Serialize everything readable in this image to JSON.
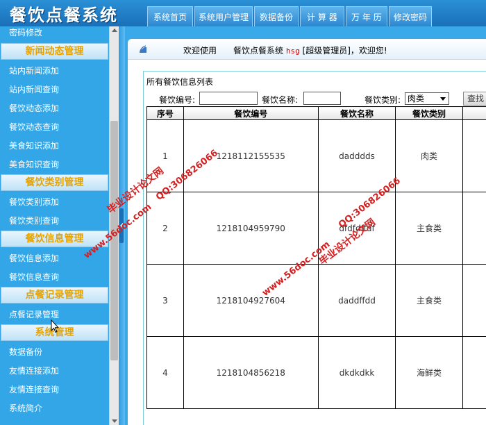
{
  "app": {
    "title": "餐饮点餐系统"
  },
  "nav": {
    "tabs": [
      {
        "label": "系统首页"
      },
      {
        "label": "系统用户管理"
      },
      {
        "label": "数据备份"
      },
      {
        "label": "计 算 器"
      },
      {
        "label": "万 年 历"
      },
      {
        "label": "修改密码"
      }
    ]
  },
  "sidebar": {
    "top_item": "密码修改",
    "groups": [
      {
        "title": "新闻动态管理",
        "items": [
          "站内新闻添加",
          "站内新闻查询",
          "餐饮动态添加",
          "餐饮动态查询",
          "美食知识添加",
          "美食知识查询"
        ]
      },
      {
        "title": "餐饮类别管理",
        "items": [
          "餐饮类别添加",
          "餐饮类别查询"
        ]
      },
      {
        "title": "餐饮信息管理",
        "items": [
          "餐饮信息添加",
          "餐饮信息查询"
        ]
      },
      {
        "title": "点餐记录管理",
        "items": [
          "点餐记录管理"
        ]
      },
      {
        "title": "系统管理",
        "items": [
          "数据备份",
          "友情连接添加",
          "友情连接查询",
          "系统简介"
        ]
      }
    ]
  },
  "welcome": {
    "label": "欢迎使用",
    "system": "餐饮点餐系统",
    "user": "hsg",
    "role_text": "[超级管理员]，欢迎您!"
  },
  "panel": {
    "title": "所有餐饮信息列表"
  },
  "filters": {
    "code_label": "餐饮编号:",
    "code_value": "",
    "name_label": "餐饮名称:",
    "name_value": "",
    "type_label": "餐饮类别:",
    "type_selected": "肉类",
    "search_button": "查找"
  },
  "table": {
    "headers": [
      "序号",
      "餐饮编号",
      "餐饮名称",
      "餐饮类别"
    ],
    "rows": [
      {
        "no": "1",
        "code": "1218112155535",
        "name": "dadddds",
        "type": "肉类"
      },
      {
        "no": "2",
        "code": "1218104959790",
        "name": "dfdfdffdf",
        "type": "主食类"
      },
      {
        "no": "3",
        "code": "1218104927604",
        "name": "daddffdd",
        "type": "主食类"
      },
      {
        "no": "4",
        "code": "1218104856218",
        "name": "dkdkdkk",
        "type": "海鲜类"
      }
    ]
  },
  "watermark": {
    "site": "www.56doc.com",
    "brand": "毕业设计论文网",
    "qq": "QQ:306826066"
  },
  "colors": {
    "sidebar_bg": "#33a6e8",
    "group_title": "#e7a300",
    "watermark": "#d42020",
    "user_highlight": "#cc0000"
  }
}
